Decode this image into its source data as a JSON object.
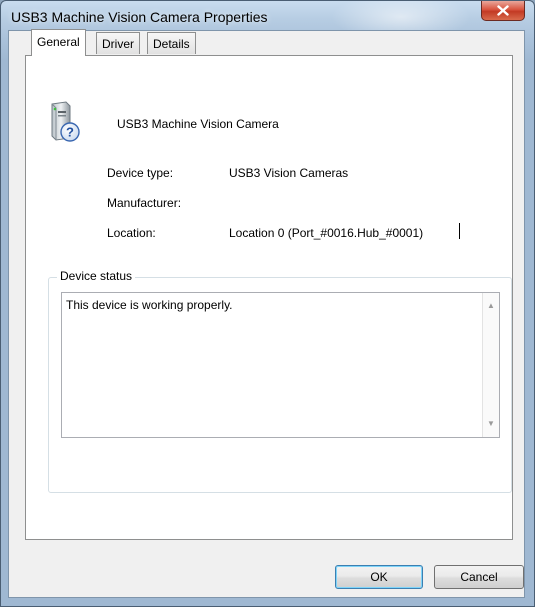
{
  "window": {
    "title": "USB3 Machine Vision Camera Properties"
  },
  "tabs": [
    {
      "label": "General",
      "active": true
    },
    {
      "label": "Driver",
      "active": false
    },
    {
      "label": "Details",
      "active": false
    }
  ],
  "device": {
    "name": "USB3 Machine Vision Camera",
    "icon": "unknown-device-icon",
    "properties": [
      {
        "label": "Device type:",
        "value": "USB3 Vision Cameras"
      },
      {
        "label": "Manufacturer:",
        "value": ""
      },
      {
        "label": "Location:",
        "value": "Location 0 (Port_#0016.Hub_#0001)"
      }
    ]
  },
  "status": {
    "group_label": "Device status",
    "text": "This device is working properly."
  },
  "buttons": {
    "ok": "OK",
    "cancel": "Cancel"
  },
  "colors": {
    "close_button": "#c8432a",
    "title_bar": "#b7cde3",
    "dialog_bg": "#f0f0f0"
  }
}
